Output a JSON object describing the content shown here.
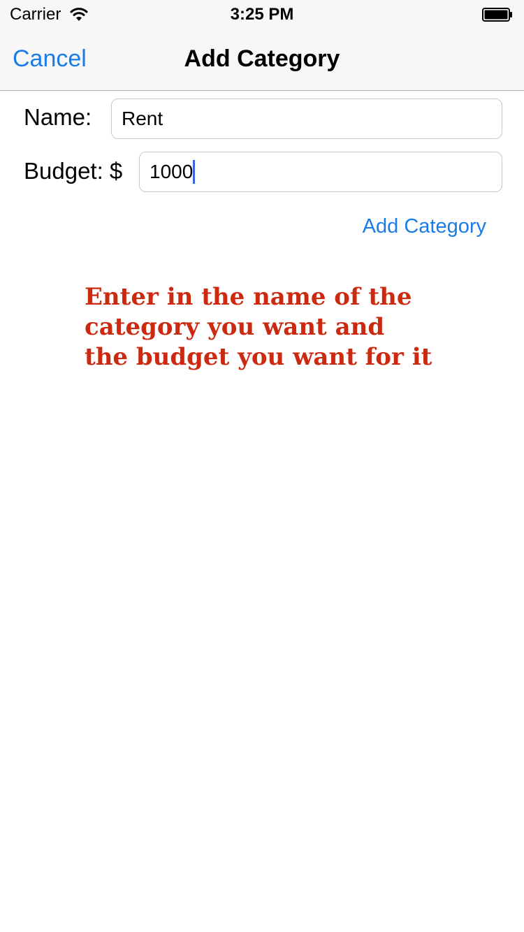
{
  "status_bar": {
    "carrier": "Carrier",
    "time": "3:25 PM",
    "wifi_icon": "wifi-icon",
    "battery_icon": "battery-icon"
  },
  "nav": {
    "cancel_label": "Cancel",
    "title": "Add Category"
  },
  "form": {
    "name_label": "Name:",
    "name_value": "Rent",
    "budget_label": "Budget: $",
    "budget_value": "1000",
    "submit_label": "Add Category"
  },
  "instruction": {
    "lines": [
      "Enter in the name of the",
      "category you want and",
      "the budget you want for it"
    ],
    "color": "#cc2a10"
  },
  "colors": {
    "accent": "#1a7ce8",
    "bar_background": "#f7f7f7"
  }
}
